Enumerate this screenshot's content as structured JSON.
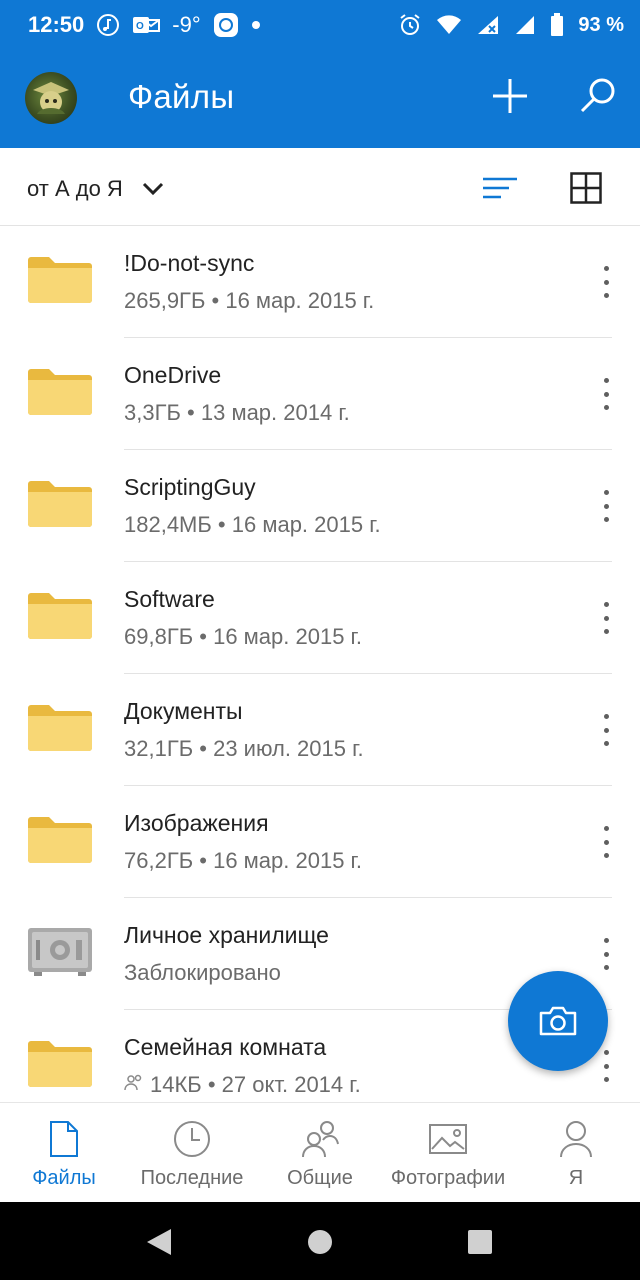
{
  "status_bar": {
    "time": "12:50",
    "temperature": "-9°",
    "battery": "93 %"
  },
  "app_bar": {
    "title": "Файлы"
  },
  "sort_bar": {
    "label": "от А до Я"
  },
  "files": [
    {
      "name": "!Do-not-sync",
      "meta": "265,9ГБ • 16 мар. 2015 г.",
      "type": "folder"
    },
    {
      "name": "OneDrive",
      "meta": "3,3ГБ • 13 мар. 2014 г.",
      "type": "folder"
    },
    {
      "name": "ScriptingGuy",
      "meta": "182,4МБ • 16 мар. 2015 г.",
      "type": "folder"
    },
    {
      "name": "Software",
      "meta": "69,8ГБ • 16 мар. 2015 г.",
      "type": "folder"
    },
    {
      "name": "Документы",
      "meta": "32,1ГБ • 23 июл. 2015 г.",
      "type": "folder"
    },
    {
      "name": "Изображения",
      "meta": "76,2ГБ • 16 мар. 2015 г.",
      "type": "folder"
    },
    {
      "name": "Личное хранилище",
      "meta": "Заблокировано",
      "type": "vault"
    },
    {
      "name": "Семейная комната",
      "meta": "14КБ • 27 окт. 2014 г.",
      "type": "shared-folder"
    }
  ],
  "bottom_nav": [
    {
      "label": "Файлы",
      "icon": "file-icon",
      "active": true
    },
    {
      "label": "Последние",
      "icon": "clock-icon",
      "active": false
    },
    {
      "label": "Общие",
      "icon": "people-icon",
      "active": false
    },
    {
      "label": "Фотографии",
      "icon": "image-icon",
      "active": false
    },
    {
      "label": "Я",
      "icon": "person-icon",
      "active": false
    }
  ],
  "colors": {
    "brand": "#0f78d4",
    "folder": "#f8d775",
    "folder_dark": "#e9b93f"
  }
}
